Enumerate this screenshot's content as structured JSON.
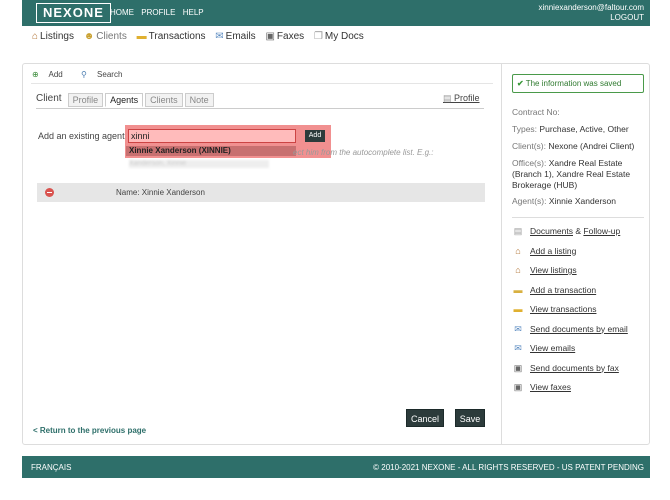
{
  "header": {
    "logo": "NEXONE",
    "nav": [
      "HOME",
      "PROFILE",
      "HELP"
    ],
    "user_email": "xinniexanderson@faltour.com",
    "logout": "LOGOUT"
  },
  "subnav": [
    {
      "label": "Listings",
      "icon": "house-icon"
    },
    {
      "label": "Clients",
      "icon": "clients-icon"
    },
    {
      "label": "Transactions",
      "icon": "folder-icon"
    },
    {
      "label": "Emails",
      "icon": "envelope-icon"
    },
    {
      "label": "Faxes",
      "icon": "fax-icon"
    },
    {
      "label": "My Docs",
      "icon": "docs-icon"
    }
  ],
  "toolbar": {
    "add": "Add",
    "search": "Search"
  },
  "tabs": {
    "title": "Client",
    "items": [
      "Profile",
      "Agents",
      "Clients",
      "Note"
    ],
    "active": "Agents",
    "profile_link": "Profile"
  },
  "agent_form": {
    "label": "Add an existing agent",
    "input_value": "xinni",
    "add_button": "Add",
    "suggestion": "Xinnie Xanderson (XINNIE)",
    "hint": "ect him from the autocomplete list. E.g.:",
    "blurred_line": "Xanderson, Xinnie"
  },
  "agent_row": {
    "name": "Name: Xinnie Xanderson"
  },
  "buttons": {
    "cancel": "Cancel",
    "save": "Save"
  },
  "return_link": "< Return to the previous page",
  "sidebar": {
    "saved_message": "The information was saved",
    "contract_no": "Contract No:",
    "types_label": "Types:",
    "types_value": "Purchase, Active, Other",
    "clients_label": "Client(s):",
    "clients_value": "Nexone (Andrei Client)",
    "offices_label": "Office(s):",
    "offices_value": "Xandre Real Estate (Branch 1), Xandre Real Estate Brokerage (HUB)",
    "agents_label": "Agent(s):",
    "agents_value": "Xinnie Xanderson",
    "actions": [
      {
        "label": "Documents",
        "extra": " & ",
        "label2": "Follow-up",
        "icon": "document-icon"
      },
      {
        "label": "Add a listing",
        "icon": "house-icon"
      },
      {
        "label": "View listings",
        "icon": "houses-icon"
      },
      {
        "label": "Add a transaction",
        "icon": "folder-add-icon"
      },
      {
        "label": "View transactions",
        "icon": "folder-open-icon"
      },
      {
        "label": "Send documents by email",
        "icon": "email-send-icon"
      },
      {
        "label": "View emails",
        "icon": "envelope-icon"
      },
      {
        "label": "Send documents by fax",
        "icon": "fax-icon"
      },
      {
        "label": "View faxes",
        "icon": "fax-view-icon"
      }
    ]
  },
  "footer": {
    "language": "FRANÇAIS",
    "copyright": "© 2010-2021 NEXONE - ALL RIGHTS RESERVED - US PATENT PENDING"
  },
  "colors": {
    "brand": "#2e6f6a",
    "highlight": "#f08a8a",
    "success": "#3a9a3a",
    "button": "#2c3b3b"
  }
}
